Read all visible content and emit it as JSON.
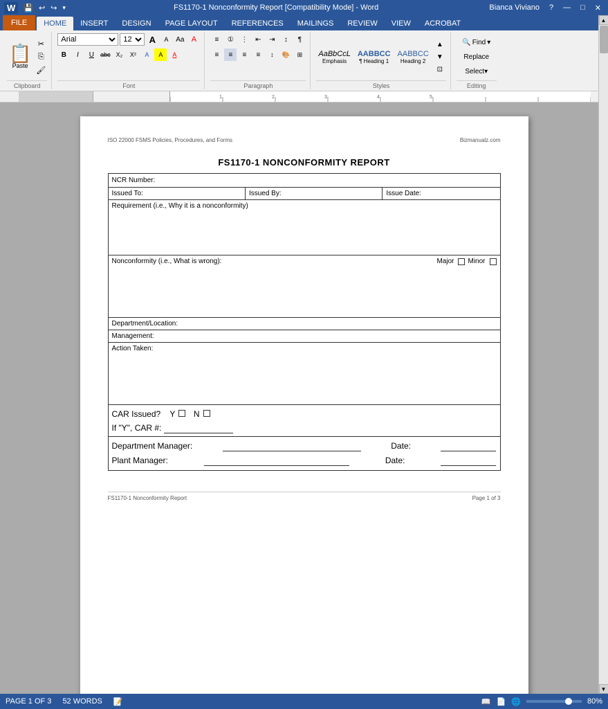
{
  "titlebar": {
    "title": "FS1170-1 Nonconformity Report [Compatibility Mode] - Word",
    "help": "?",
    "minimize": "—",
    "maximize": "□",
    "close": "✕"
  },
  "ribbon": {
    "tabs": [
      "FILE",
      "HOME",
      "INSERT",
      "DESIGN",
      "PAGE LAYOUT",
      "REFERENCES",
      "MAILINGS",
      "REVIEW",
      "VIEW",
      "ACROBAT"
    ],
    "active_tab": "HOME",
    "font": {
      "name": "Arial",
      "size": "12",
      "grow_label": "A",
      "shrink_label": "A",
      "clear_label": "A",
      "bold": "B",
      "italic": "I",
      "underline": "U",
      "strikethrough": "abc",
      "subscript": "X₂",
      "superscript": "X²"
    },
    "paragraph_label": "Paragraph",
    "font_label": "Font",
    "clipboard_label": "Clipboard",
    "styles_label": "Styles",
    "editing_label": "Editing",
    "paste_label": "Paste",
    "styles": [
      {
        "name": "Emphasis",
        "preview": "AaBbCcL"
      },
      {
        "name": "¶ Heading 1",
        "preview": "AABBCC"
      },
      {
        "name": "Heading 2",
        "preview": "AABBCC"
      }
    ],
    "find_label": "Find",
    "replace_label": "Replace",
    "select_label": "Select"
  },
  "user": {
    "name": "Bianca Viviano"
  },
  "document": {
    "header_left": "ISO 22000 FSMS Policies, Procedures, and Forms",
    "header_right": "Bizmanualz.com",
    "title": "FS1170-1 NONCONFORMITY REPORT",
    "ncr_label": "NCR Number:",
    "issued_to_label": "Issued To:",
    "issued_by_label": "Issued By:",
    "issue_date_label": "Issue Date:",
    "requirement_label": "Requirement (i.e., Why it is a nonconformity)",
    "nonconformity_label": "Nonconformity (i.e., What is wrong):",
    "major_label": "Major",
    "minor_label": "Minor",
    "dept_label": "Department/Location:",
    "mgmt_label": "Management:",
    "action_label": "Action Taken:",
    "car_issued_label": "CAR Issued?",
    "car_y_label": "Y",
    "car_n_label": "N",
    "car_number_label": "If \"Y\", CAR #:",
    "dept_manager_label": "Department Manager:",
    "plant_manager_label": "Plant Manager:",
    "date_label": "Date:",
    "footer_left": "FS1170-1 Nonconformity Report",
    "footer_center": "Page 1 of 3"
  },
  "statusbar": {
    "page_info": "PAGE 1 OF 3",
    "word_count": "52 WORDS",
    "zoom": "80%",
    "zoom_value": 80
  }
}
